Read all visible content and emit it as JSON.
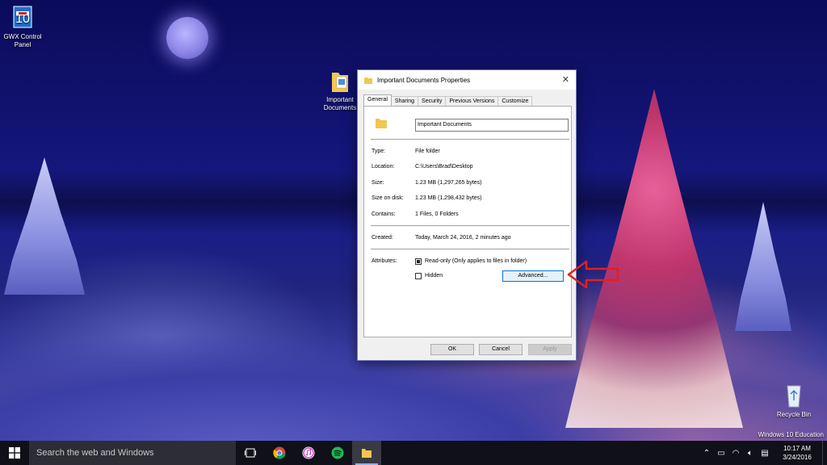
{
  "desktop": {
    "icons": [
      {
        "label": "GWX Control Panel"
      },
      {
        "label": "Important Documents"
      },
      {
        "label": "Recycle Bin"
      }
    ],
    "watermark": "Windows 10 Education"
  },
  "dialog": {
    "title": "Important Documents Properties",
    "close_label": "✕",
    "tabs": [
      "General",
      "Sharing",
      "Security",
      "Previous Versions",
      "Customize"
    ],
    "active_tab": "General",
    "folder_name": "Important Documents",
    "fields": {
      "type_label": "Type:",
      "type_value": "File folder",
      "location_label": "Location:",
      "location_value": "C:\\Users\\Brad\\Desktop",
      "size_label": "Size:",
      "size_value": "1.23 MB (1,297,265 bytes)",
      "size_on_disk_label": "Size on disk:",
      "size_on_disk_value": "1.23 MB (1,298,432 bytes)",
      "contains_label": "Contains:",
      "contains_value": "1 Files, 0 Folders",
      "created_label": "Created:",
      "created_value": "Today, March 24, 2016, 2 minutes ago",
      "attributes_label": "Attributes:"
    },
    "readonly": {
      "label": "Read-only (Only applies to files in folder)",
      "checked": true
    },
    "hidden": {
      "label": "Hidden",
      "checked": false
    },
    "advanced_label": "Advanced...",
    "ok_label": "OK",
    "cancel_label": "Cancel",
    "apply_label": "Apply"
  },
  "taskbar": {
    "search_placeholder": "Search the web and Windows",
    "apps": [
      "task-view",
      "chrome",
      "itunes",
      "spotify",
      "file-explorer"
    ],
    "time": "10:17 AM",
    "date": "3/24/2016"
  },
  "colors": {
    "accent": "#0078d7",
    "arrow": "#e02020",
    "taskbar": "#101018"
  }
}
